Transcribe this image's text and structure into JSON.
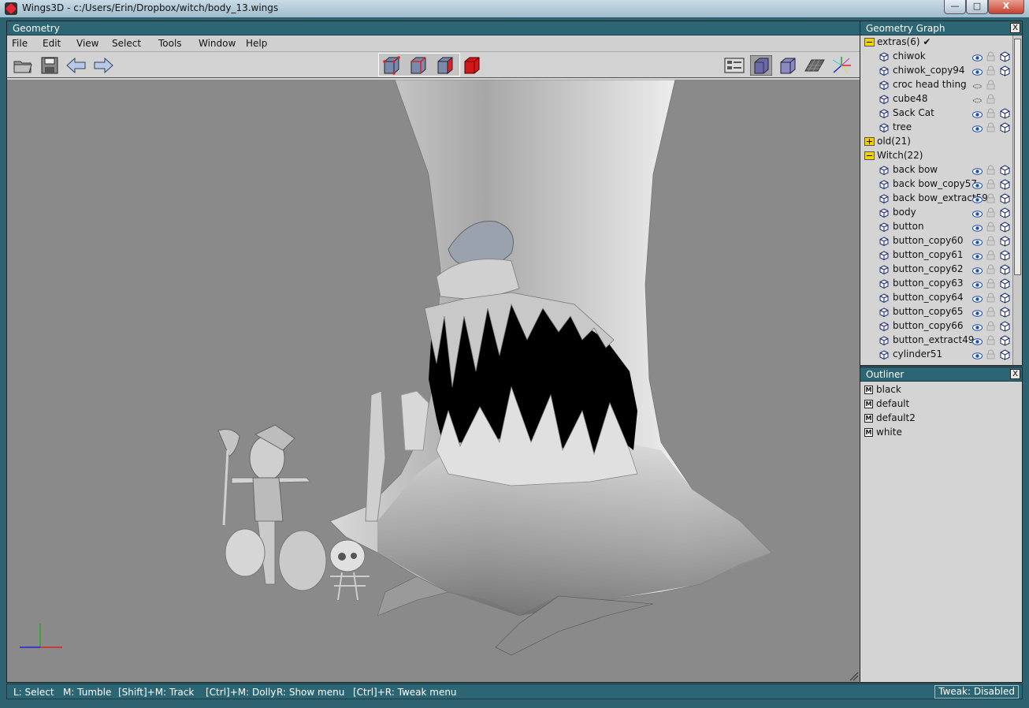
{
  "window": {
    "title": "Wings3D - c:/Users/Erin/Dropbox/witch/body_13.wings",
    "min_label": "—",
    "max_label": "□",
    "close_label": "X"
  },
  "geometry": {
    "title": "Geometry",
    "menu": [
      "File",
      "Edit",
      "View",
      "Select",
      "Tools",
      "Window",
      "Help"
    ]
  },
  "graph": {
    "title": "Geometry Graph",
    "close_label": "X",
    "groups": [
      {
        "name": "extras",
        "count": "(6)",
        "check": "✔",
        "items": [
          {
            "name": "chiwok",
            "visible": true
          },
          {
            "name": "chiwok_copy94",
            "visible": true
          },
          {
            "name": "croc head thing",
            "visible": false
          },
          {
            "name": "cube48",
            "visible": false
          },
          {
            "name": "Sack Cat",
            "visible": true
          },
          {
            "name": "tree",
            "visible": true
          }
        ]
      },
      {
        "name": "old",
        "count": "(21)",
        "check": "",
        "items": []
      },
      {
        "name": "Witch",
        "count": "(22)",
        "check": "",
        "items": [
          {
            "name": "back bow",
            "visible": true
          },
          {
            "name": "back bow_copy57",
            "visible": true
          },
          {
            "name": "back bow_extract59",
            "visible": true
          },
          {
            "name": "body",
            "visible": true
          },
          {
            "name": "button",
            "visible": true
          },
          {
            "name": "button_copy60",
            "visible": true
          },
          {
            "name": "button_copy61",
            "visible": true
          },
          {
            "name": "button_copy62",
            "visible": true
          },
          {
            "name": "button_copy63",
            "visible": true
          },
          {
            "name": "button_copy64",
            "visible": true
          },
          {
            "name": "button_copy65",
            "visible": true
          },
          {
            "name": "button_copy66",
            "visible": true
          },
          {
            "name": "button_extract49",
            "visible": true
          },
          {
            "name": "cylinder51",
            "visible": true
          }
        ]
      }
    ]
  },
  "outliner": {
    "title": "Outliner",
    "close_label": "X",
    "material_marker": "M",
    "items": [
      "black",
      "default",
      "default2",
      "white"
    ]
  },
  "status": {
    "hints": [
      "L: Select",
      "M: Tumble",
      "[Shift]+M: Track",
      "[Ctrl]+M: Dolly",
      "R: Show menu",
      "[Ctrl]+R: Tweak menu"
    ],
    "tweak": "Tweak: Disabled"
  },
  "colors": {
    "panel_title": "#2c6573",
    "viewport_bg": "#8a8a8a",
    "folder": "#f5d000",
    "eye": "#1f4fa8"
  }
}
